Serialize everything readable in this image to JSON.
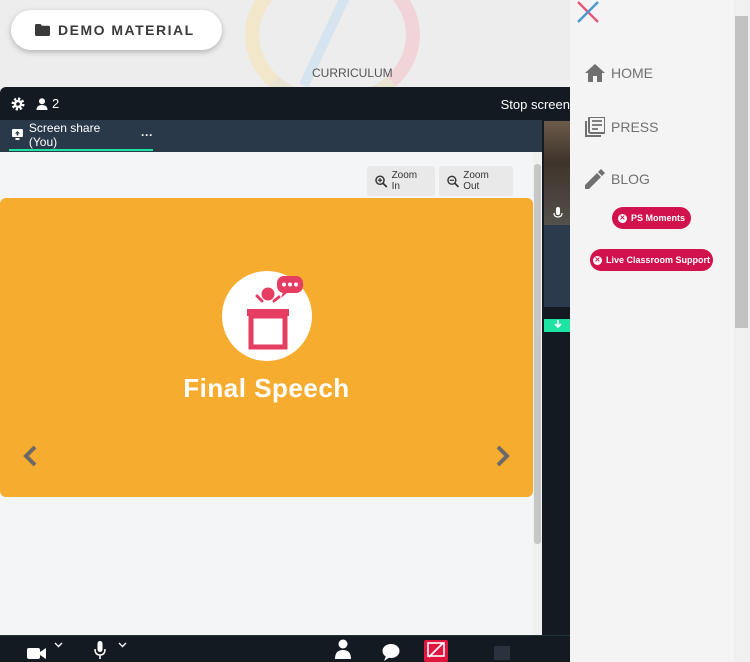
{
  "background": {
    "demo_button_label": "DEMO MATERIAL",
    "curriculum_label": "CURRICULUM"
  },
  "meeting": {
    "participant_count": "2",
    "stop_label": "Stop screen",
    "tab_label": "Screen share (You)",
    "tab_more": "···",
    "zoom_in_label": "Zoom In",
    "zoom_out_label": "Zoom Out",
    "slide_title": "Final Speech"
  },
  "menu": {
    "items": [
      {
        "label": "HOME",
        "icon": "home-icon"
      },
      {
        "label": "PRESS",
        "icon": "newspaper-icon"
      },
      {
        "label": "BLOG",
        "icon": "pencil-icon"
      }
    ],
    "pills": [
      {
        "label": "PS Moments"
      },
      {
        "label": "Live Classroom Support"
      }
    ]
  },
  "colors": {
    "accent_pink": "#d1124d",
    "slide_orange": "#f6ac2f",
    "tab_underline": "#1fe3a3",
    "meeting_dark": "#131a22"
  }
}
